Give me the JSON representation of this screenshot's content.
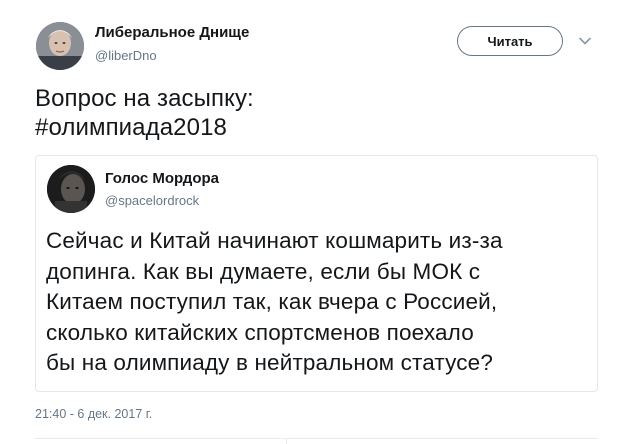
{
  "tweet": {
    "author": {
      "name": "Либеральное Днище",
      "handle": "@liberDno"
    },
    "follow_label": "Читать",
    "text_lines": [
      "Вопрос на засыпку:",
      "#олимпиада2018"
    ],
    "timestamp": "21:40 - 6 дек. 2017 г."
  },
  "quoted_tweet": {
    "author": {
      "name": "Голос Мордора",
      "handle": "@spacelordrock"
    },
    "text_lines": [
      "Сейчас и Китай начинают кошмарить из-за",
      "допинга. Как вы думаете, если бы МОК с",
      "Китаем поступил так, как вчера с Россией,",
      "сколько китайских спортсменов поехало",
      "бы на олимпиаду в нейтральном статусе?"
    ]
  },
  "icons": {
    "more": "chevron-down-icon"
  },
  "colors": {
    "text": "#14171a",
    "secondary": "#657786",
    "border": "#e1e8ed"
  }
}
